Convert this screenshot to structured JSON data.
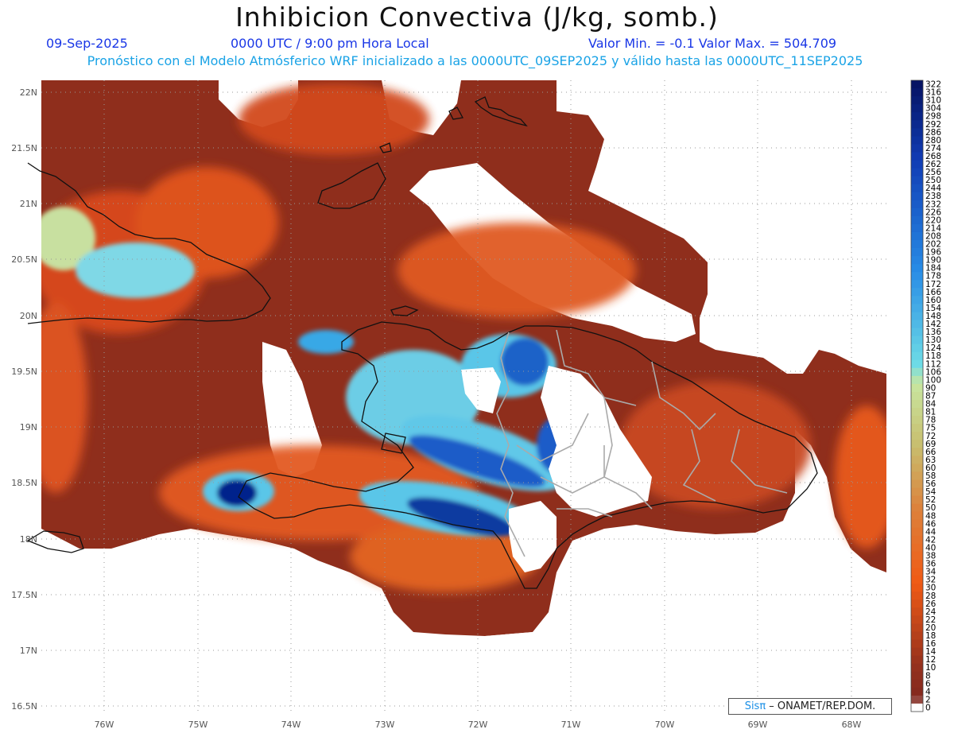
{
  "header": {
    "title": "Inhibicion Convectiva (J/kg, somb.)",
    "date": "09-Sep-2025",
    "time": "0000 UTC / 9:00 pm Hora Local",
    "min_max": "Valor Min. = -0.1  Valor Max. = 504.709",
    "model_info": "Pronóstico con el Modelo Atmósferico WRF inicializado a las 0000UTC_09SEP2025 y válido hasta las  0000UTC_11SEP2025"
  },
  "map": {
    "lat_labels": [
      "22N",
      "21.5N",
      "21N",
      "20.5N",
      "20N",
      "19.5N",
      "19N",
      "18.5N",
      "18N",
      "17.5N",
      "17N",
      "16.5N"
    ],
    "lon_labels": [
      "76W",
      "75W",
      "74W",
      "73W",
      "72W",
      "71W",
      "70W",
      "69W",
      "68W"
    ],
    "lat_range": [
      16.5,
      22.05
    ],
    "lon_range": [
      -76.65,
      -67.55
    ],
    "colors": {
      "low": "#8a2a1c",
      "mid": "#e85a1e",
      "light": "#cfe0a2",
      "cyan": "#62d0e8",
      "blue": "#1060c8",
      "navy": "#04228a"
    }
  },
  "colorbar": {
    "labels": [
      "322",
      "316",
      "310",
      "304",
      "298",
      "292",
      "286",
      "280",
      "274",
      "268",
      "262",
      "256",
      "250",
      "244",
      "238",
      "232",
      "226",
      "220",
      "214",
      "208",
      "202",
      "196",
      "190",
      "184",
      "178",
      "172",
      "166",
      "160",
      "154",
      "148",
      "142",
      "136",
      "130",
      "124",
      "118",
      "112",
      "106",
      "100",
      "90",
      "87",
      "84",
      "81",
      "78",
      "75",
      "72",
      "69",
      "66",
      "63",
      "60",
      "58",
      "56",
      "54",
      "52",
      "50",
      "48",
      "46",
      "44",
      "42",
      "40",
      "38",
      "36",
      "34",
      "32",
      "30",
      "28",
      "26",
      "24",
      "22",
      "20",
      "18",
      "16",
      "14",
      "12",
      "10",
      "8",
      "6",
      "4",
      "2",
      "0"
    ]
  },
  "credit": {
    "brand": "Sisπ",
    "text": " – ONAMET/REP.DOM."
  }
}
